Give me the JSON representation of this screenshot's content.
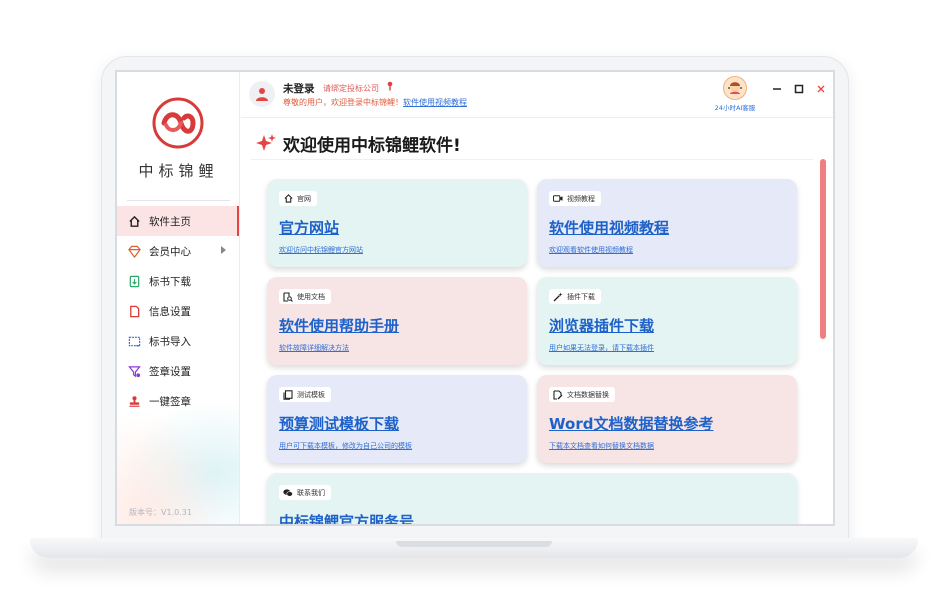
{
  "app": {
    "brand_name": "中标锦鲤",
    "version_label": "版本号：V1.0.31",
    "accent_color": "#e64444",
    "link_color": "#1e62c9"
  },
  "sidebar": {
    "items": [
      {
        "label": "软件主页",
        "icon": "home-icon",
        "active": true
      },
      {
        "label": "会员中心",
        "icon": "diamond-icon",
        "has_submenu": true
      },
      {
        "label": "标书下载",
        "icon": "download-file-icon"
      },
      {
        "label": "信息设置",
        "icon": "document-icon"
      },
      {
        "label": "标书导入",
        "icon": "import-icon"
      },
      {
        "label": "签章设置",
        "icon": "filter-icon"
      },
      {
        "label": "一键签章",
        "icon": "stamp-icon"
      }
    ]
  },
  "header": {
    "login_status": "未登录",
    "bind_hint": "请绑定投标公司",
    "welcome_text": "尊敬的用户，欢迎登录中标锦鲤！",
    "tutorial_link": "软件使用视频教程",
    "service_label": "24小时AI客服"
  },
  "main": {
    "title": "欢迎使用中标锦鲤软件!",
    "cards": [
      {
        "tag": "官网",
        "icon": "home-icon",
        "title": "官方网站",
        "subtitle": "欢迎访问中标锦鲤官方网站"
      },
      {
        "tag": "视频教程",
        "icon": "video-icon",
        "title": "软件使用视频教程",
        "subtitle": "欢迎观看软件使用视频教程"
      },
      {
        "tag": "使用文档",
        "icon": "doc-search-icon",
        "title": "软件使用帮助手册",
        "subtitle": "软件故障详细解决方法"
      },
      {
        "tag": "插件下载",
        "icon": "magic-wand-icon",
        "title": "浏览器插件下载",
        "subtitle": "用户如果无法登录，请下载本插件"
      },
      {
        "tag": "测试模板",
        "icon": "copy-icon",
        "title": "预算测试模板下载",
        "subtitle": "用户可下载本模板，修改为自己公司的模板"
      },
      {
        "tag": "文档数据替换",
        "icon": "edit-doc-icon",
        "title": "Word文档数据替换参考",
        "subtitle": "下载本文档查看如何替换文档数据"
      },
      {
        "tag": "联系我们",
        "icon": "wechat-icon",
        "title": "中标锦鲤官方服务号",
        "subtitle": ""
      }
    ]
  }
}
